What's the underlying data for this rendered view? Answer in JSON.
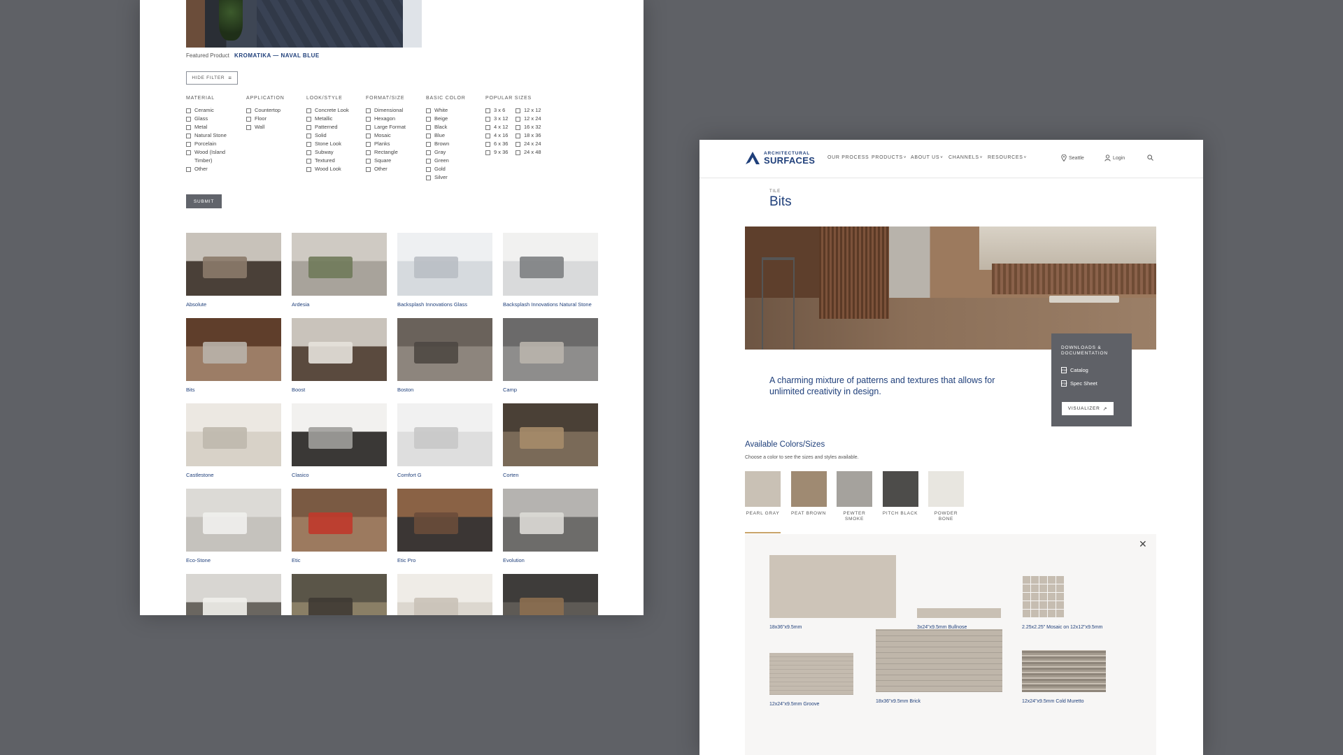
{
  "left": {
    "featured": {
      "label": "Featured Product",
      "product": "KROMATIKA — NAVAL BLUE"
    },
    "hide_filter": "HIDE FILTER",
    "filters": [
      {
        "heading": "MATERIAL",
        "options": [
          "Ceramic",
          "Glass",
          "Metal",
          "Natural Stone",
          "Porcelain",
          "Wood (Island Timber)",
          "Other"
        ]
      },
      {
        "heading": "APPLICATION",
        "options": [
          "Countertop",
          "Floor",
          "Wall"
        ]
      },
      {
        "heading": "LOOK/STYLE",
        "options": [
          "Concrete Look",
          "Metallic",
          "Patterned",
          "Solid",
          "Stone Look",
          "Subway",
          "Textured",
          "Wood Look"
        ]
      },
      {
        "heading": "FORMAT/SIZE",
        "options": [
          "Dimensional",
          "Hexagon",
          "Large Format",
          "Mosaic",
          "Planks",
          "Rectangle",
          "Square",
          "Other"
        ]
      },
      {
        "heading": "BASIC COLOR",
        "options": [
          "White",
          "Beige",
          "Black",
          "Blue",
          "Brown",
          "Gray",
          "Green",
          "Gold",
          "Silver"
        ]
      },
      {
        "heading": "POPULAR SIZES",
        "options": [
          "3 x 6",
          "12 x 12",
          "3 x 12",
          "12 x 24",
          "4 x 12",
          "16 x 32",
          "4 x 16",
          "18 x 36",
          "6 x 36",
          "24 x 24",
          "9 x 36",
          "24 x 48"
        ]
      }
    ],
    "submit": "SUBMIT",
    "products": [
      {
        "name": "Absolute",
        "colors": [
          "#c8c2ba",
          "#4a4038",
          "#8b7a6a"
        ]
      },
      {
        "name": "Ardesia",
        "colors": [
          "#cfcac3",
          "#a8a39b",
          "#6f7a5a"
        ]
      },
      {
        "name": "Backsplash Innovations Glass",
        "colors": [
          "#eef0f2",
          "#d6dade",
          "#b9bec4"
        ]
      },
      {
        "name": "Backsplash Innovations Natural Stone",
        "colors": [
          "#f1f1f0",
          "#d9dadb",
          "#7d7f82"
        ]
      },
      {
        "name": "Bits",
        "colors": [
          "#5f3e2b",
          "#9c7d66",
          "#b9b3aa"
        ]
      },
      {
        "name": "Boost",
        "colors": [
          "#c9c3bb",
          "#5a4a3e",
          "#e6e2dc"
        ]
      },
      {
        "name": "Boston",
        "colors": [
          "#6a625b",
          "#8d857d",
          "#4e4842"
        ]
      },
      {
        "name": "Camp",
        "colors": [
          "#6b6a6a",
          "#8e8d8c",
          "#b9b4ac"
        ]
      },
      {
        "name": "Castlestone",
        "colors": [
          "#ece8e2",
          "#d8d2c8",
          "#bfb8ad"
        ]
      },
      {
        "name": "Clasico",
        "colors": [
          "#f2f1ef",
          "#3a3836",
          "#a09e9b"
        ]
      },
      {
        "name": "Comfort G",
        "colors": [
          "#f1f1f1",
          "#dedede",
          "#c8c8c8"
        ]
      },
      {
        "name": "Corten",
        "colors": [
          "#4a4036",
          "#7a6a58",
          "#a68c6a"
        ]
      },
      {
        "name": "Eco-Stone",
        "colors": [
          "#dcdad6",
          "#c5c2bd",
          "#f0efed"
        ]
      },
      {
        "name": "Etic",
        "colors": [
          "#7a5a43",
          "#9c7a5f",
          "#c0392b"
        ]
      },
      {
        "name": "Etic Pro",
        "colors": [
          "#8a6245",
          "#3b3634",
          "#6a4d3a"
        ]
      },
      {
        "name": "Evolution",
        "colors": [
          "#b5b3b0",
          "#6d6c6a",
          "#dcdad6"
        ]
      },
      {
        "name": "",
        "colors": [
          "#d8d6d2",
          "#6a6660",
          "#f1efeb"
        ]
      },
      {
        "name": "",
        "colors": [
          "#5a5548",
          "#8a7f66",
          "#3e3a33"
        ]
      },
      {
        "name": "",
        "colors": [
          "#efece7",
          "#dcd7cf",
          "#c9c2b7"
        ]
      },
      {
        "name": "",
        "colors": [
          "#3e3c3a",
          "#5e5a55",
          "#8c6e50"
        ]
      }
    ]
  },
  "right": {
    "logo": {
      "line1": "ARCHITECTURAL",
      "line2": "SURFACES"
    },
    "nav": [
      "OUR PROCESS",
      "PRODUCTS",
      "ABOUT US",
      "CHANNELS",
      "RESOURCES"
    ],
    "location": "Seattle",
    "login": "Login",
    "crumb": "TILE",
    "title": "Bits",
    "downloads": {
      "heading": "DOWNLOADS & DOCUMENTATION",
      "catalog": "Catalog",
      "spec": "Spec Sheet",
      "visualizer": "VISUALIZER"
    },
    "tagline": "A charming mixture of patterns and textures that allows for unlimited creativity in design.",
    "available_heading": "Available Colors/Sizes",
    "available_sub": "Choose a color to see the sizes and styles available.",
    "swatches": [
      {
        "name": "PEARL GRAY",
        "color": "#c9c1b5"
      },
      {
        "name": "PEAT BROWN",
        "color": "#9f8a72"
      },
      {
        "name": "PEWTER SMOKE",
        "color": "#a5a29d"
      },
      {
        "name": "PITCH BLACK",
        "color": "#4d4c4a"
      },
      {
        "name": "POWDER BONE",
        "color": "#e8e6e0"
      }
    ],
    "sizes": [
      {
        "label": "18x36\"x9.5mm",
        "color": "#cdc4b8"
      },
      {
        "label": "3x24\"x9.5mm Bullnose",
        "color": "#c9c0b4"
      },
      {
        "label": "2.25x2.25\" Mosaic on 12x12\"x9.5mm",
        "color": "#c6bdb1"
      },
      {
        "label": "12x24\"x9.5mm Groove",
        "color": "#c4bbaf"
      },
      {
        "label": "18x36\"x9.5mm Brick",
        "color": "#bfb6aa"
      },
      {
        "label": "12x24\"x9.5mm Cold Muretto",
        "color": "#b3aa9e"
      }
    ]
  }
}
